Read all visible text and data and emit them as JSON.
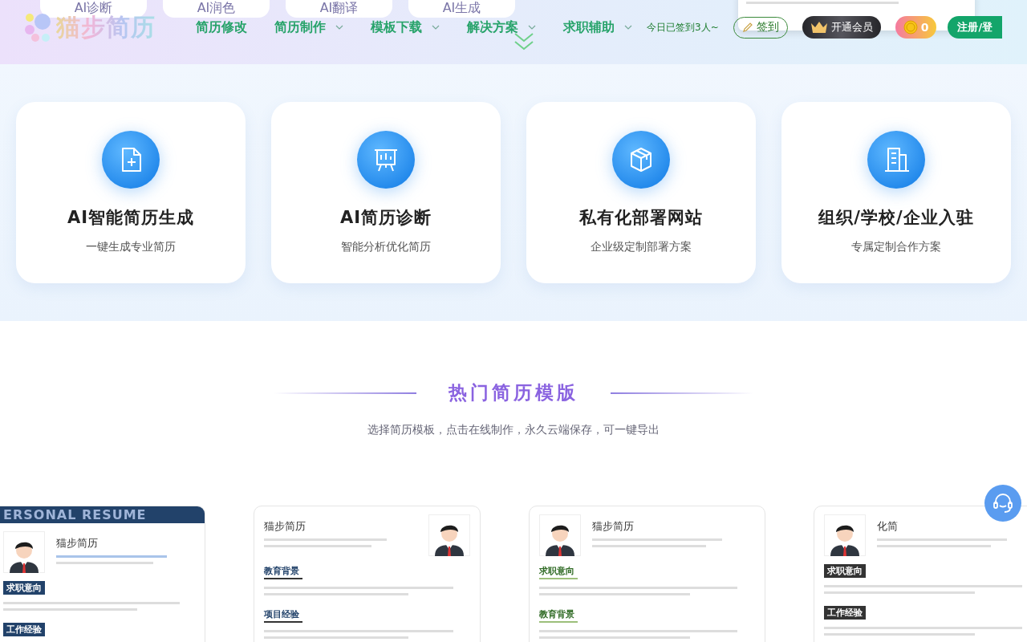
{
  "header": {
    "logo": "猫步简历",
    "ai_tabs": [
      "AI诊断",
      "AI润色",
      "AI翻译",
      "AI生成"
    ],
    "nav": [
      {
        "label": "简历修改",
        "dropdown": false
      },
      {
        "label": "简历制作",
        "dropdown": true
      },
      {
        "label": "模板下载",
        "dropdown": true
      },
      {
        "label": "解决方案",
        "dropdown": true
      },
      {
        "label": "求职辅助",
        "dropdown": true
      }
    ],
    "checkin_count": "今日已签到3人~",
    "checkin_button": "签到",
    "vip_button": "开通会员",
    "coins": "0",
    "register_button": "注册/登"
  },
  "features": [
    {
      "title": "AI智能简历生成",
      "subtitle": "一键生成专业简历"
    },
    {
      "title": "AI简历诊断",
      "subtitle": "智能分析优化简历"
    },
    {
      "title": "私有化部署网站",
      "subtitle": "企业级定制部署方案"
    },
    {
      "title": "组织/学校/企业入驻",
      "subtitle": "专属定制合作方案"
    }
  ],
  "section": {
    "title": "热门简历模版",
    "subtitle": "选择简历模板，点击在线制作，永久云端保存，可一键导出"
  },
  "templates": [
    {
      "kind": "banner",
      "banner": "ERSONAL RESUME",
      "name": "猫步简历",
      "sections": [
        "求职意向",
        "工作经验"
      ]
    },
    {
      "kind": "classic",
      "name": "猫步简历",
      "sections": [
        "教育背景",
        "项目经验"
      ]
    },
    {
      "kind": "green",
      "name": "猫步简历",
      "sections": [
        "求职意向",
        "教育背景"
      ]
    },
    {
      "kind": "dark",
      "name": "化简",
      "sections": [
        "求职意向",
        "工作经验"
      ]
    }
  ]
}
